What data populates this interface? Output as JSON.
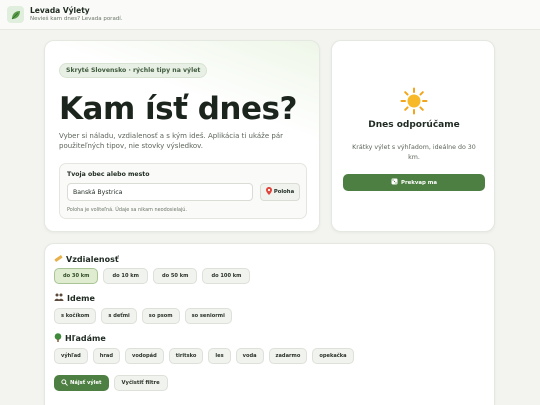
{
  "header": {
    "brand_name": "Levada Výlety",
    "brand_tagline": "Nevieš kam dnes? Levada poradí."
  },
  "hero": {
    "pill": "Skryté Slovensko · rýchle tipy na výlet",
    "title": "Kam ísť dnes?",
    "description": "Vyber si náladu, vzdialenosť a s kým ideš. Aplikácia ti ukáže pár použiteľných tipov, nie stovky výsledkov.",
    "location": {
      "label": "Tvoja obec alebo mesto",
      "value": "Banská Bystrica",
      "placeholder": "",
      "button_label": "Poloha",
      "note": "Poloha je voliteľná. Údaje sa nikam neodosielajú."
    }
  },
  "recommendation": {
    "title": "Dnes odporúčame",
    "description": "Krátky výlet s výhľadom, ideálne do 30 km.",
    "button_label": "Prekvap ma"
  },
  "filters": {
    "distance": {
      "title": "Vzdialenosť",
      "options": [
        "do 30 km",
        "do 10 km",
        "do 50 km",
        "do 100 km"
      ],
      "selected": "do 30 km"
    },
    "company": {
      "title": "Ideme",
      "options": [
        "s kočíkom",
        "s deťmi",
        "so psom",
        "so seniormi"
      ]
    },
    "looking_for": {
      "title": "Hľadáme",
      "options": [
        "výhľad",
        "hrad",
        "vodopád",
        "tiritsko",
        "les",
        "voda",
        "zadarmo",
        "opekačka"
      ]
    },
    "find_button": "Nájsť výlet",
    "clear_button": "Vyčistiť filtre"
  },
  "colors": {
    "accent": "#4e7f42",
    "chip_active": "#dfeccf",
    "background": "#f3f4f0"
  },
  "icons": {
    "logo": "leaf-icon",
    "location": "pin-icon",
    "sun": "sun-icon",
    "surprise": "dice-icon",
    "distance": "ruler-icon",
    "company": "people-icon",
    "looking_for": "tree-icon",
    "search": "search-icon"
  }
}
